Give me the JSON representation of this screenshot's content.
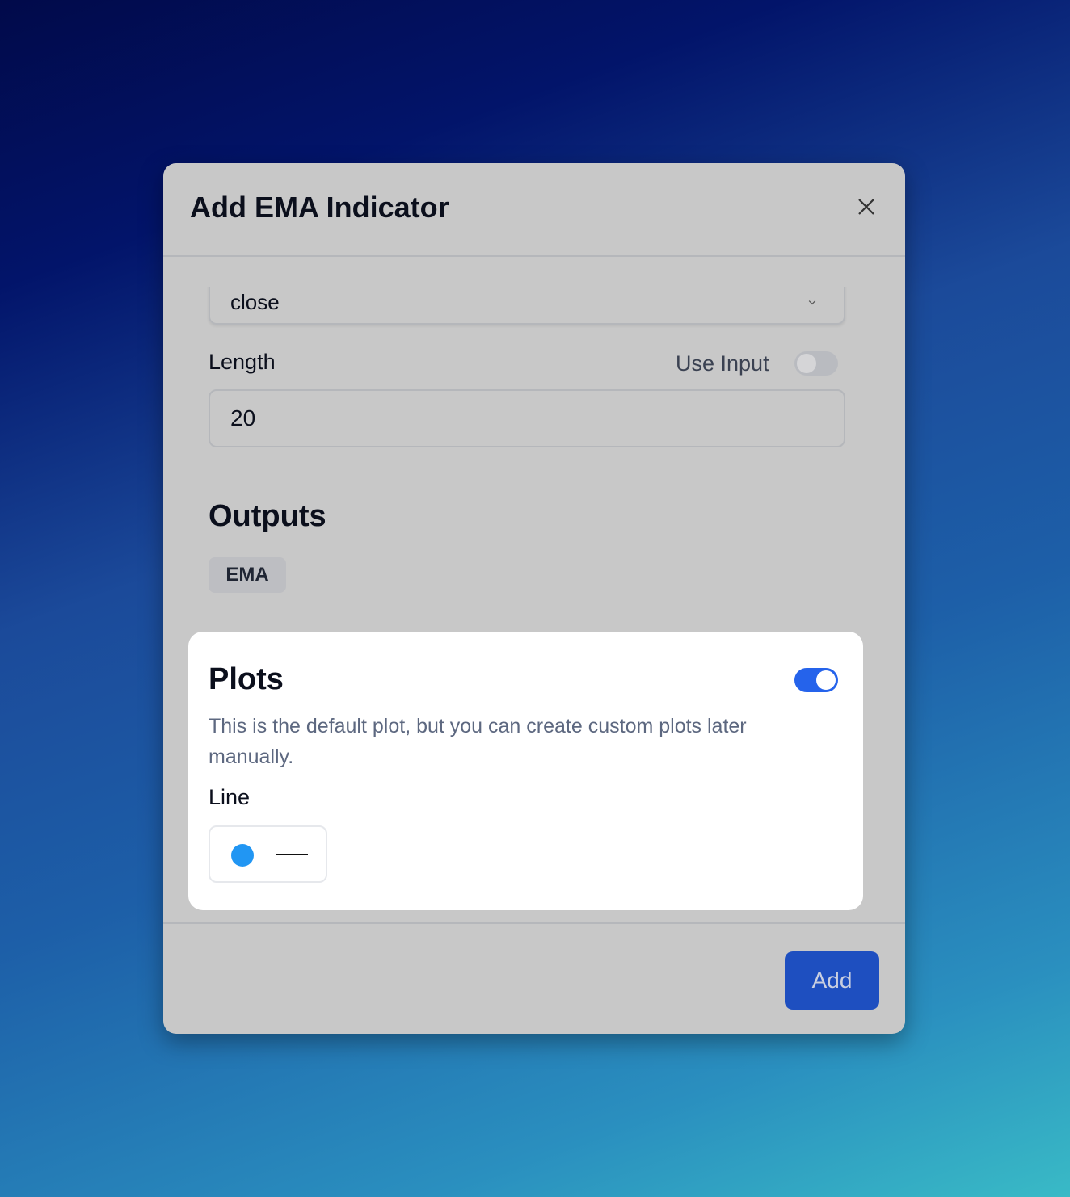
{
  "modal": {
    "title": "Add EMA Indicator"
  },
  "source": {
    "value": "close"
  },
  "length": {
    "label": "Length",
    "use_input_label": "Use Input",
    "use_input_on": false,
    "value": "20"
  },
  "outputs": {
    "heading": "Outputs",
    "items": [
      "EMA"
    ]
  },
  "plots": {
    "heading": "Plots",
    "enabled": true,
    "description": "This is the default plot, but you can create custom plots later manually.",
    "line_label": "Line",
    "line_color": "#2196f3"
  },
  "footer": {
    "add_label": "Add"
  },
  "colors": {
    "accent": "#2563eb",
    "button": "#1e4fc0"
  }
}
